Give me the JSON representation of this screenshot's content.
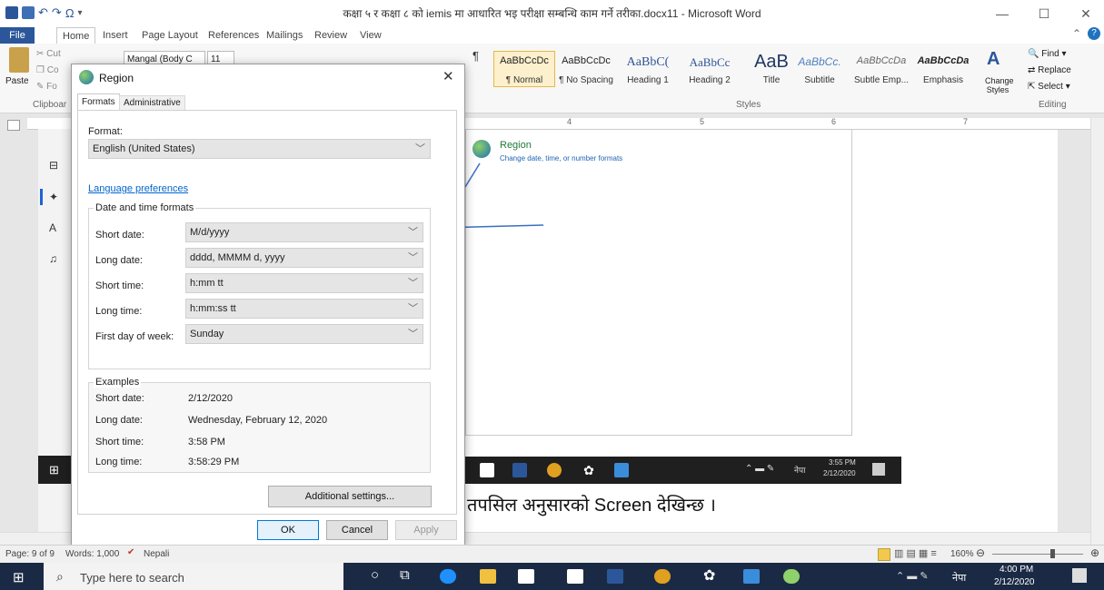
{
  "window": {
    "title": "कक्षा ५ र कक्षा ८ को iemis मा आधारित भइ परीक्षा सम्बन्धि काम गर्ने तरीका.docx11 - Microsoft Word",
    "minimize": "—",
    "restore": "☐",
    "close": "✕"
  },
  "ribbon": {
    "tabs": [
      "File",
      "Home",
      "Insert",
      "Page Layout",
      "References",
      "Mailings",
      "Review",
      "View"
    ],
    "clipboard": {
      "paste": "Paste",
      "cut": "Cut",
      "copy": "Co",
      "format": "Fo",
      "group_label": "Clipboar"
    },
    "font": {
      "name": "Mangal (Body C",
      "size": "11"
    },
    "styles": [
      {
        "sample": "AaBbCcDc",
        "name": "¶ Normal"
      },
      {
        "sample": "AaBbCcDc",
        "name": "¶ No Spacing"
      },
      {
        "sample": "AaBbC(",
        "name": "Heading 1"
      },
      {
        "sample": "AaBbCc",
        "name": "Heading 2"
      },
      {
        "sample": "AaB",
        "name": "Title"
      },
      {
        "sample": "AaBbCc.",
        "name": "Subtitle"
      },
      {
        "sample": "AaBbCcDa",
        "name": "Subtle Emp..."
      },
      {
        "sample": "AaBbCcDa",
        "name": "Emphasis"
      }
    ],
    "styles_group_label": "Styles",
    "change_styles": "Change Styles",
    "editing": {
      "find": "Find",
      "replace": "Replace",
      "select": "Select",
      "group_label": "Editing"
    }
  },
  "ruler_marks": [
    "4",
    "5",
    "6",
    "7"
  ],
  "embedded": {
    "region_title": "Region",
    "region_desc": "Change date, time, or number formats",
    "taskbar_time": "3:55 PM",
    "taskbar_date": "2/12/2020",
    "taskbar_lang": "नेपा"
  },
  "doc_text": "तपसिल अनुसारको Screen देखिन्छ ।",
  "dialog": {
    "title": "Region",
    "tabs": [
      "Formats",
      "Administrative"
    ],
    "format_label": "Format:",
    "format_value": "English (United States)",
    "language_link": "Language preferences",
    "dt_group": "Date and time formats",
    "fields": [
      {
        "label": "Short date:",
        "value": "M/d/yyyy"
      },
      {
        "label": "Long date:",
        "value": "dddd, MMMM d, yyyy"
      },
      {
        "label": "Short time:",
        "value": "h:mm tt"
      },
      {
        "label": "Long time:",
        "value": "h:mm:ss tt"
      },
      {
        "label": "First day of week:",
        "value": "Sunday"
      }
    ],
    "examples_group": "Examples",
    "examples": [
      {
        "label": "Short date:",
        "value": "2/12/2020"
      },
      {
        "label": "Long date:",
        "value": "Wednesday, February 12, 2020"
      },
      {
        "label": "Short time:",
        "value": "3:58 PM"
      },
      {
        "label": "Long time:",
        "value": "3:58:29 PM"
      }
    ],
    "additional_settings": "Additional settings...",
    "ok": "OK",
    "cancel": "Cancel",
    "apply": "Apply"
  },
  "statusbar": {
    "page": "Page: 9 of 9",
    "words": "Words: 1,000",
    "language": "Nepali",
    "zoom": "160%"
  },
  "taskbar": {
    "search_placeholder": "Type here to search",
    "time": "4:00 PM",
    "date": "2/12/2020",
    "lang": "नेपा"
  },
  "colors": {
    "word_blue": "#2b579a",
    "taskbar": "#1b2a44",
    "link": "#0066cc"
  }
}
